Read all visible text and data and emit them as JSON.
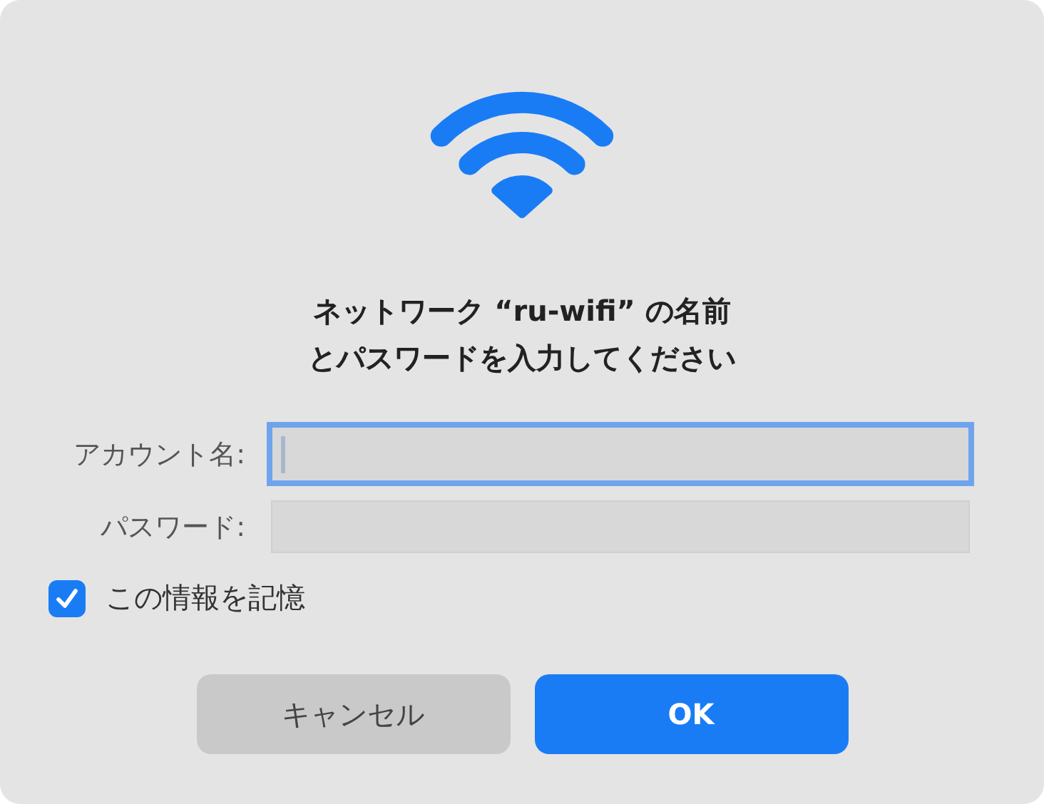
{
  "title_lines": [
    "ネットワーク “ru-wifi” の名前",
    "とパスワードを入力してください"
  ],
  "fields": [
    {
      "label": "アカウント名:",
      "focused": true
    },
    {
      "label": "パスワード:",
      "focused": false
    }
  ],
  "remember": {
    "label": "この情報を記憶",
    "checked": true
  },
  "buttons": [
    {
      "label": "キャンセル",
      "kind": "secondary"
    },
    {
      "label": "OK",
      "kind": "primary"
    }
  ]
}
